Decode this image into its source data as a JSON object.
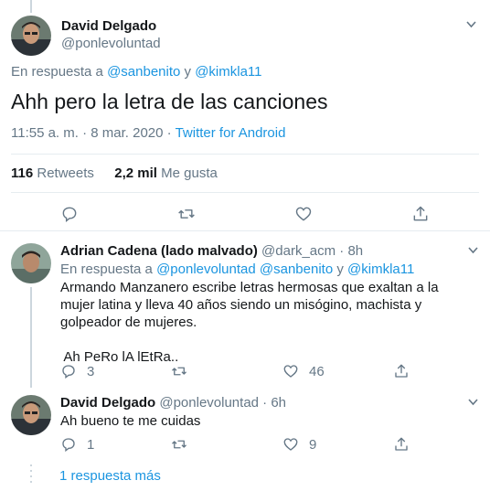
{
  "main_tweet": {
    "author_name": "David Delgado",
    "author_handle": "@ponlevoluntad",
    "reply_prefix": "En respuesta a",
    "reply_user_1": "@sanbenito",
    "reply_join": "y",
    "reply_user_2": "@kimkla11",
    "text": "Ahh pero la letra de las canciones",
    "timestamp": "11:55 a. m. · 8 mar. 2020 ·",
    "source": "Twitter for Android",
    "retweets_count": "116",
    "retweets_label": "Retweets",
    "likes_count": "2,2 mil",
    "likes_label": "Me gusta"
  },
  "replies": [
    {
      "author_name": "Adrian Cadena (lado malvado)",
      "author_handle": "@dark_acm · 8h",
      "reply_prefix": "En respuesta a",
      "reply_users": "@ponlevoluntad @sanbenito",
      "reply_join": "y",
      "reply_user_last": "@kimkla11",
      "text_paragraph_1": "Armando Manzanero escribe letras hermosas que exaltan a la mujer latina y lleva 40 años siendo un misógino, machista y golpeador de mujeres.",
      "text_paragraph_2": " Ah PeRo lA lEtRa..",
      "reply_count": "3",
      "retweet_count": "",
      "like_count": "46"
    },
    {
      "author_name": "David Delgado",
      "author_handle": "@ponlevoluntad · 6h",
      "text": "Ah bueno te me cuidas",
      "reply_count": "1",
      "retweet_count": "",
      "like_count": "9"
    }
  ],
  "more_replies_label": "1 respuesta más",
  "icons": [
    "caret-down-icon",
    "reply-icon",
    "retweet-icon",
    "like-icon",
    "share-icon"
  ],
  "colors": {
    "link": "#1b95e0",
    "secondary_text": "#657786",
    "divider": "#e6ecf0"
  }
}
